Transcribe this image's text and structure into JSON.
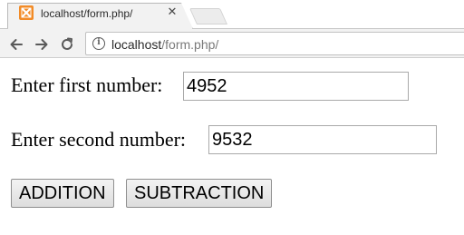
{
  "browser": {
    "tab": {
      "title": "localhost/form.php/",
      "close_glyph": "✕",
      "favicon_icon": "xampp-icon"
    },
    "nav": {
      "back_icon": "back-arrow-icon",
      "forward_icon": "forward-arrow-icon",
      "reload_icon": "reload-icon"
    },
    "address": {
      "info_glyph": "i",
      "host": "localhost",
      "path": "/form.php/"
    }
  },
  "form": {
    "first_label": "Enter first number:",
    "first_value": "4952",
    "second_label": "Enter second number:",
    "second_value": "9532",
    "addition_label": "ADDITION",
    "subtraction_label": "SUBTRACTION"
  },
  "colors": {
    "favicon": "#f28b27",
    "toolbar": "#f2f2f2"
  }
}
